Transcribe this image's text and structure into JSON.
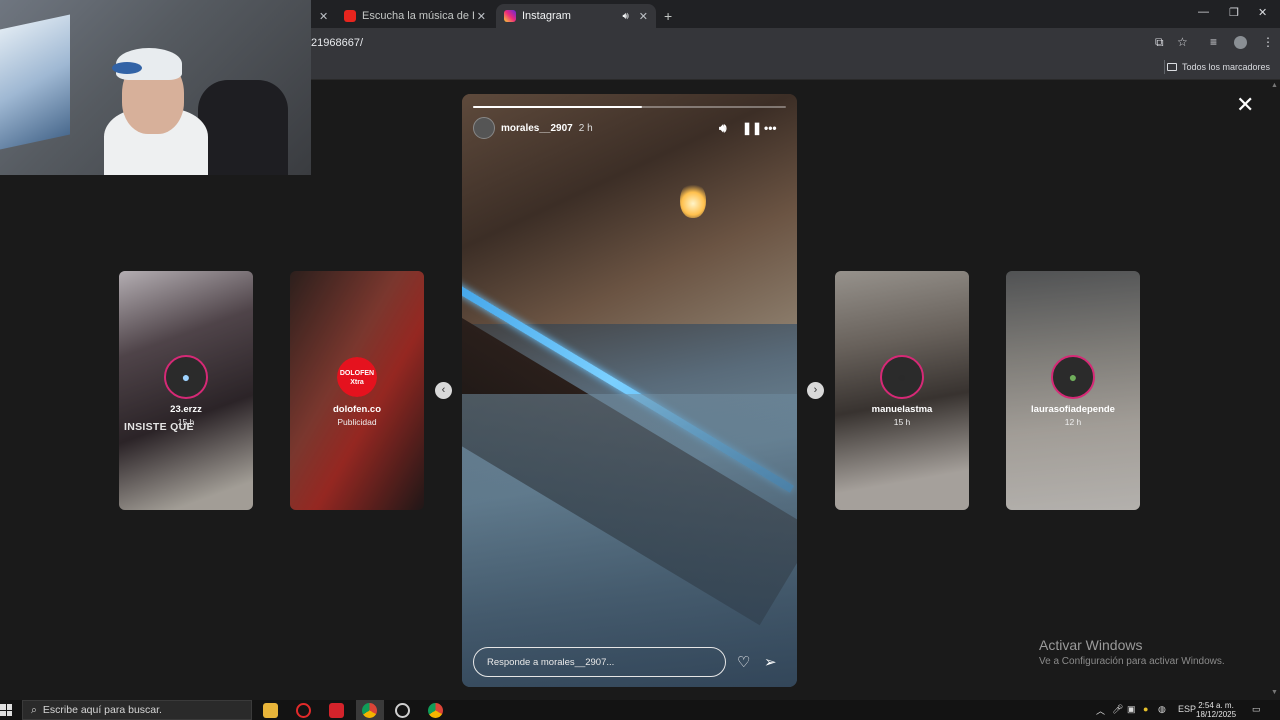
{
  "browser": {
    "tabs": [
      {
        "label": "",
        "close": "✕"
      },
      {
        "label": "Escucha la música de Esteban /",
        "close": "✕"
      },
      {
        "label": "Instagram",
        "close": "✕"
      }
    ],
    "new_tab": "+",
    "url": "21968667/",
    "bookmarks_label": "Todos los marcadores",
    "window_controls": {
      "minimize": "—",
      "maximize": "❐",
      "close": "✕"
    }
  },
  "viewer": {
    "close_icon": "✕",
    "story": {
      "username": "morales__2907",
      "time": "2 h",
      "progress": 0.54,
      "reply_placeholder": "Responde a morales__2907..."
    },
    "side_stories_left": [
      {
        "username": "23.erzz",
        "sub": "15 h",
        "overlay_text": "INSISTE QUE"
      },
      {
        "username": "dolofen.co",
        "sub": "Publicidad",
        "logo_text": "DOLOFEN Xtra"
      }
    ],
    "side_stories_right": [
      {
        "username": "manuelastma",
        "sub": "15 h"
      },
      {
        "username": "laurasofiadepende",
        "sub": "12 h"
      }
    ],
    "prev_icon": "‹",
    "next_icon": "›"
  },
  "watermark": {
    "title": "Activar Windows",
    "subtitle": "Ve a Configuración para activar Windows."
  },
  "taskbar": {
    "search_placeholder": "Escribe aquí para buscar.",
    "language": "ESP",
    "time": "2:54 a. m.",
    "date": "18/12/2025"
  },
  "colors": {
    "instagram_accent": "#d62976",
    "youtube_red": "#ff0000",
    "background": "#1a1a1a"
  }
}
